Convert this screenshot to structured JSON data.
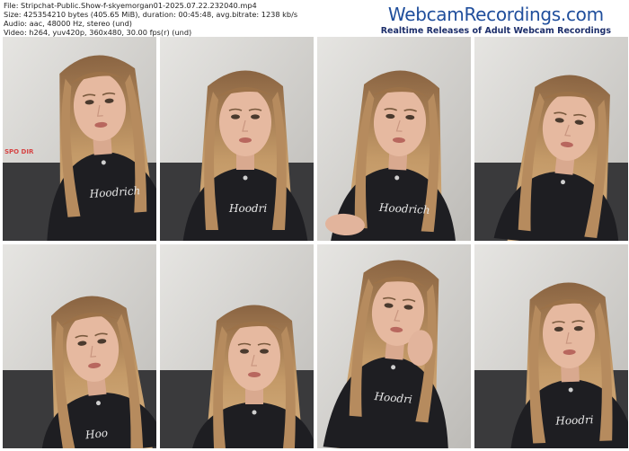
{
  "file_info": {
    "file": "File: Stripchat-Public.Show-f-skyemorgan01-2025.07.22.232040.mp4",
    "size": "Size: 425354210 bytes (405.65 MiB), duration: 00:45:48, avg.bitrate: 1238 kb/s",
    "audio": "Audio: aac, 48000 Hz, stereo (und)",
    "video": "Video: h264, yuv420p, 360x480, 30.00 fps(r) (und)"
  },
  "brand": {
    "title": "WebcamRecordings.com",
    "subtitle": "Realtime Releases of Adult Webcam Recordings"
  },
  "colors": {
    "brand_blue": "#1f4e9c",
    "hair": "#b48a5c",
    "shirt": "#1e1e22",
    "skin": "#e6b9a0",
    "wall": "#d9d8d5"
  },
  "thumbnails": [
    {
      "id": 1,
      "shirt_text": "Hoodrich",
      "side_text": "SPO DIR"
    },
    {
      "id": 2,
      "shirt_text": "Hoodri"
    },
    {
      "id": 3,
      "shirt_text": "Hoodrich"
    },
    {
      "id": 4,
      "shirt_text": ""
    },
    {
      "id": 5,
      "shirt_text": "Hoo"
    },
    {
      "id": 6,
      "shirt_text": ""
    },
    {
      "id": 7,
      "shirt_text": "Hoodri"
    },
    {
      "id": 8,
      "shirt_text": "Hoodri"
    }
  ]
}
